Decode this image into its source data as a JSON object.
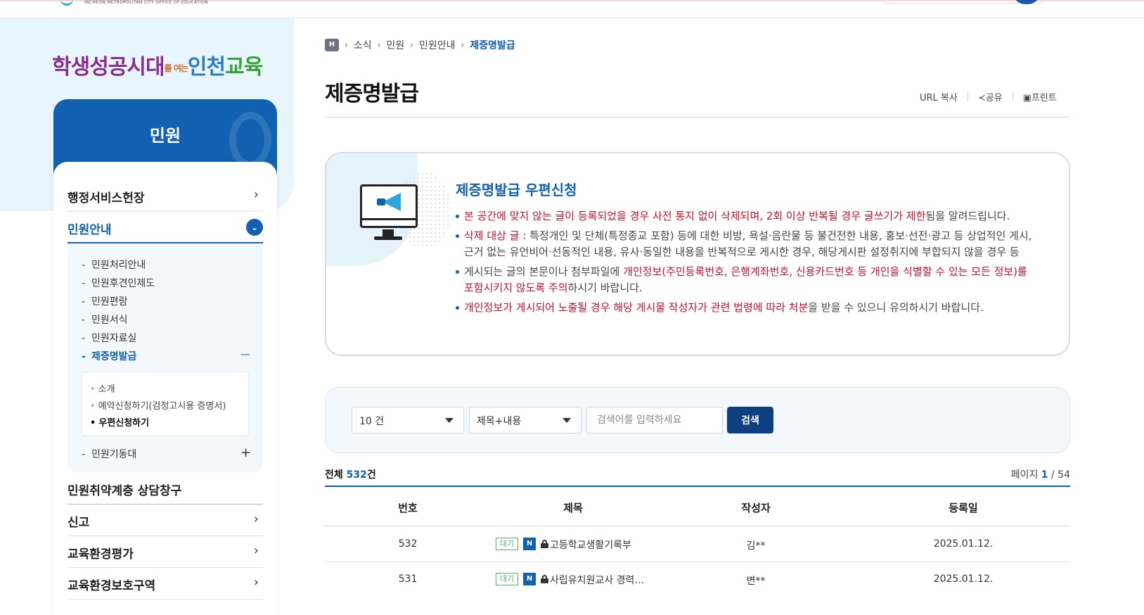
{
  "header": {
    "logo_subtitle": "INCHEON METROPOLITAN CITY OFFICE OF EDUCATION"
  },
  "slogan": {
    "part1": "학생성공시대",
    "part2": "를 여는",
    "part3": "인천",
    "part4": "교육"
  },
  "sidebar": {
    "section_title": "민원",
    "items": [
      {
        "label": "행정서비스헌장",
        "state": "collapsed"
      },
      {
        "label": "민원안내",
        "state": "expanded"
      },
      {
        "label": "민원취약계층 상담창구",
        "state": "plain"
      },
      {
        "label": "신고",
        "state": "collapsed"
      },
      {
        "label": "교육환경평가",
        "state": "collapsed"
      },
      {
        "label": "교육환경보호구역",
        "state": "collapsed"
      }
    ],
    "submenu": [
      {
        "label": "민원처리안내"
      },
      {
        "label": "민원후견인제도"
      },
      {
        "label": "민원편람"
      },
      {
        "label": "민원서식"
      },
      {
        "label": "민원자료실"
      },
      {
        "label": "제증명발급"
      },
      {
        "label": "민원기동대"
      }
    ],
    "third_menu": [
      {
        "label": "소개"
      },
      {
        "label": "예약신청하기(검정고시용 증명서)"
      },
      {
        "label": "우편신청하기"
      }
    ]
  },
  "breadcrumb": {
    "home": "H",
    "items": [
      "소식",
      "민원",
      "민원안내",
      "제증명발급"
    ]
  },
  "page": {
    "title": "제증명발급",
    "tools": {
      "url_copy": "URL 복사",
      "share": "공유",
      "print": "프린트"
    }
  },
  "notice": {
    "title": "제증명발급 우편신청",
    "items": [
      {
        "red": "본 공간에 맞지 않는 글이 등록되었을 경우 사전 통지 없이 삭제되며, 2회 이상 반복될 경우 글쓰기가 제한",
        "rest": "됨을 알려드립니다."
      },
      {
        "red": "삭제 대상 글",
        "rest": " : 특정개인 및 단체(특정종교 포함) 등에 대한 비방, 욕설·음란물 등 불건전한 내용, 홍보·선전·광고 등 상업적인 게시, 근거 없는 유언비어·선동적인 내용, 유사·동일한 내용을 반복적으로 게시한 경우, 해당게시판 설정취지에 부합되지 않을 경우 등"
      },
      {
        "pre": "게시되는 글의 본문이나 첨부파일에 ",
        "red": "개인정보(주민등록번호, 은행계좌번호, 신용카드번호 등 개인을 식별할 수 있는 모든 정보)를 포함시키지 않도록 주의",
        "rest": "하시기 바랍니다."
      },
      {
        "red": "개인정보가 게시되어 노출될 경우 해당 게시물 작성자가 관련 법령에 따라 처분",
        "rest": "을 받을 수 있으니 유의하시기 바랍니다."
      }
    ]
  },
  "search": {
    "page_size_selected": "10 건",
    "field_selected": "제목+내용",
    "placeholder": "검색어를 입력하세요",
    "button_label": "검색"
  },
  "list_summary": {
    "total_label": "전체",
    "total_count": "532",
    "total_unit": "건",
    "page_label": "페이지",
    "current_page": "1",
    "page_sep": " / ",
    "total_pages": "54"
  },
  "table": {
    "columns": [
      "번호",
      "제목",
      "작성자",
      "등록일"
    ],
    "rows": [
      {
        "no": "532",
        "status": "대기",
        "new": "N",
        "title": "고등학교생활기록부",
        "author": "김**",
        "date": "2025.01.12."
      },
      {
        "no": "531",
        "status": "대기",
        "new": "N",
        "title": "사립유치원교사 경력…",
        "author": "변**",
        "date": "2025.01.12."
      }
    ]
  }
}
